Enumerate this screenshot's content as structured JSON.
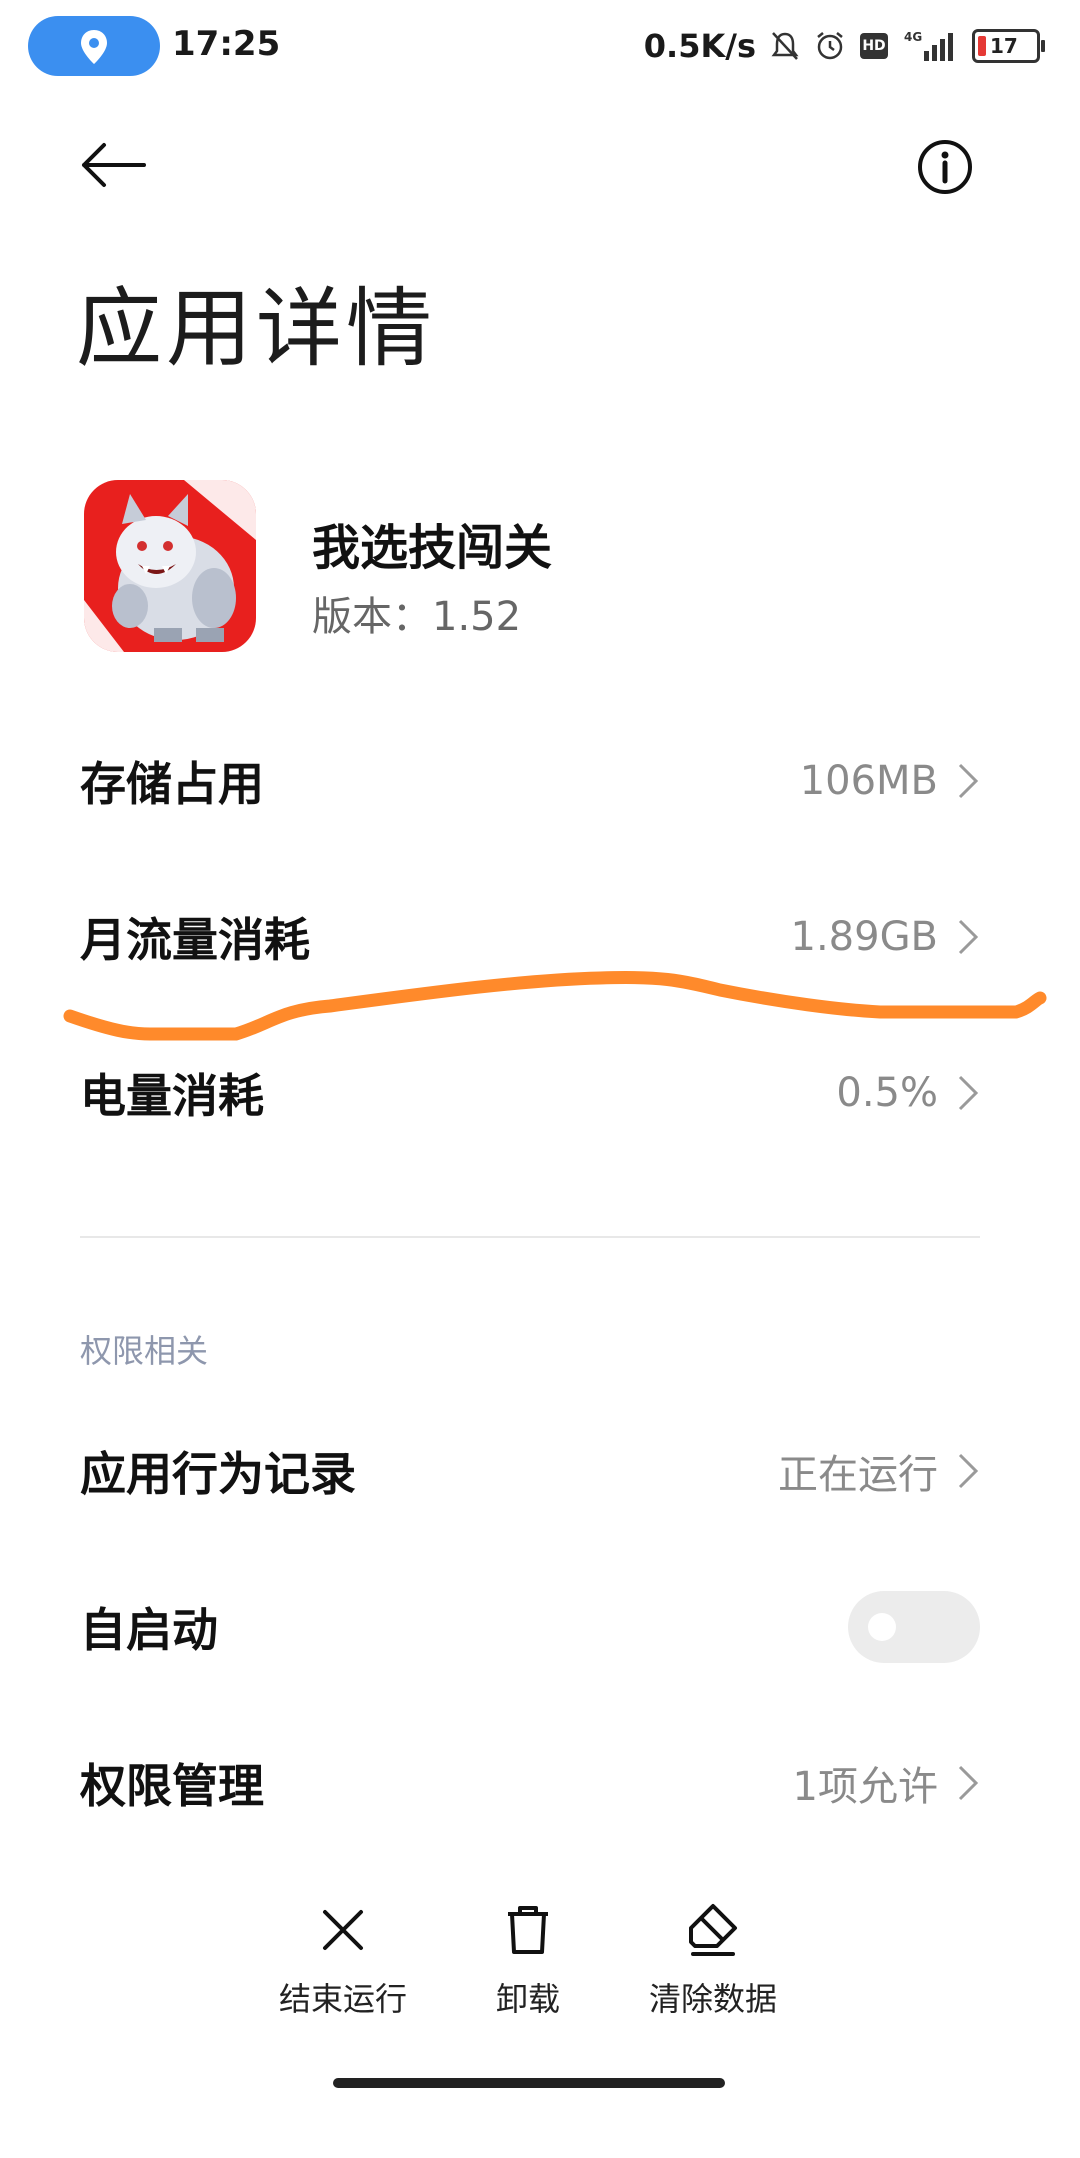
{
  "status_bar": {
    "time": "17:25",
    "net_speed": "0.5K/s",
    "network": "4G",
    "hd": "HD",
    "battery": "17",
    "icons": [
      "location-icon",
      "mute-bell-icon",
      "alarm-icon",
      "hd-icon",
      "signal-icon",
      "battery-icon"
    ]
  },
  "header": {
    "title": "应用详情",
    "back_icon": "arrow-left-icon",
    "info_icon": "info-icon"
  },
  "app": {
    "name": "我选技闯关",
    "version": "版本：1.52"
  },
  "usage": [
    {
      "label": "存储占用",
      "value": "106MB"
    },
    {
      "label": "月流量消耗",
      "value": "1.89GB"
    },
    {
      "label": "电量消耗",
      "value": "0.5%"
    }
  ],
  "permissions_section": {
    "header": "权限相关",
    "behavior_record": {
      "label": "应用行为记录",
      "value": "正在运行"
    },
    "autostart": {
      "label": "自启动",
      "enabled": false
    },
    "permission_management": {
      "label": "权限管理",
      "value": "1项允许"
    }
  },
  "actions": [
    {
      "label": "结束运行",
      "icon": "close-icon"
    },
    {
      "label": "卸载",
      "icon": "trash-icon"
    },
    {
      "label": "清除数据",
      "icon": "eraser-icon"
    }
  ],
  "colors": {
    "accent_blue": "#3b8ff0",
    "annotation_orange": "#ff8a2b",
    "section_header": "#8e97ad"
  }
}
